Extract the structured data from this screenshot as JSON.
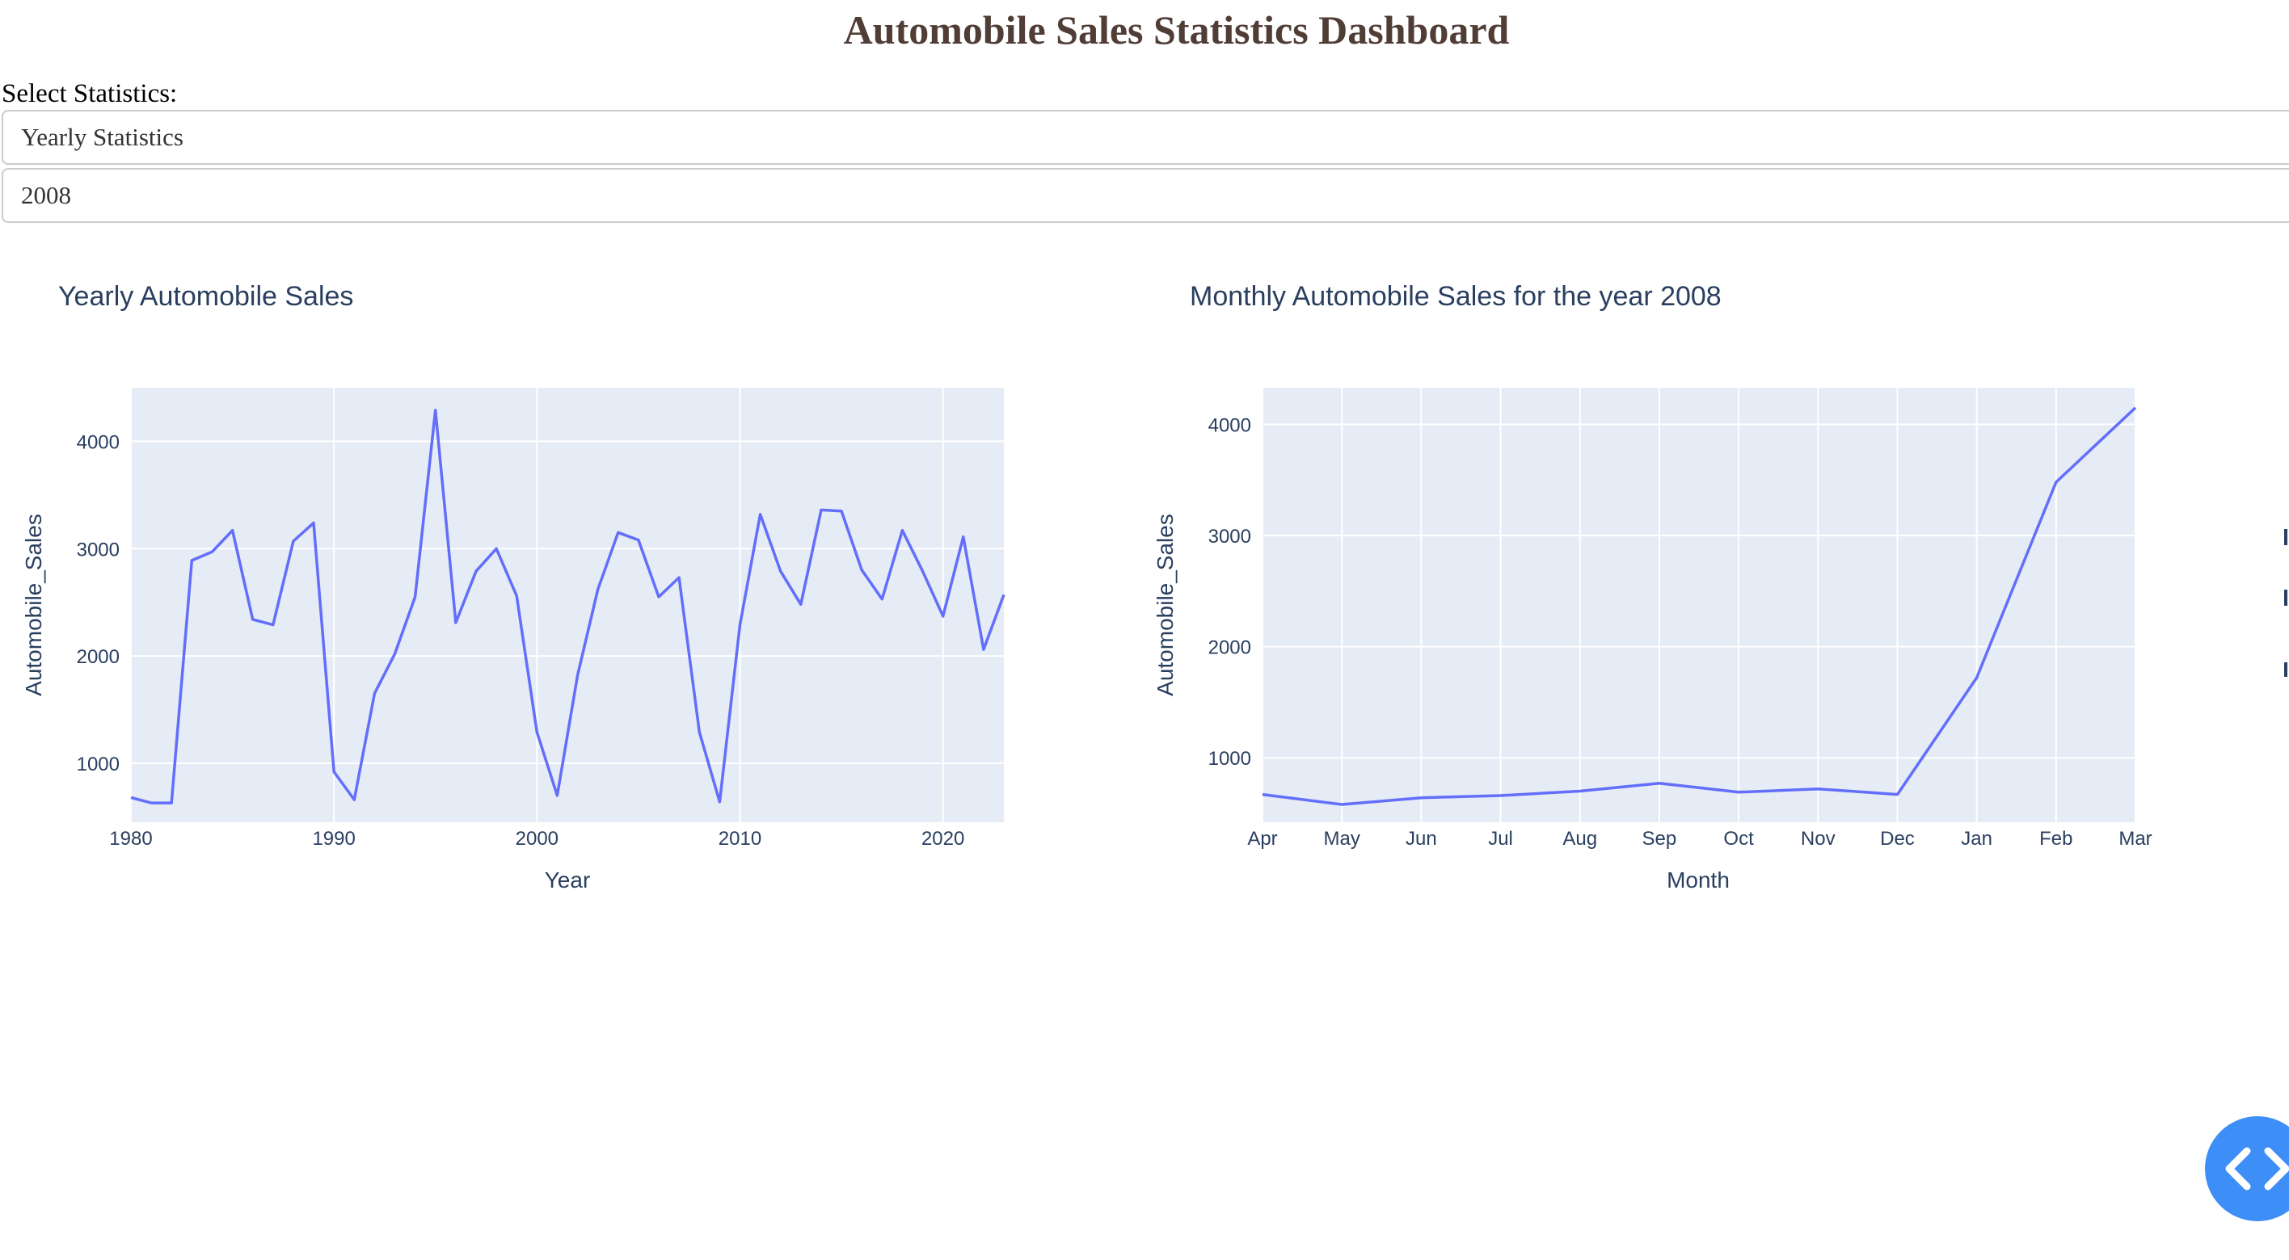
{
  "header": {
    "title": "Automobile Sales Statistics Dashboard"
  },
  "controls": {
    "select_label": "Select Statistics:",
    "statistics_dropdown": {
      "selected": "Yearly Statistics"
    },
    "year_dropdown": {
      "selected": "2008"
    }
  },
  "colors": {
    "title": "#503D36",
    "line": "#636EFA",
    "plot_bg": "#E5ECF6",
    "fab": "#3e8ef7"
  },
  "fab": {
    "icon": "code-icon"
  },
  "chart_data": [
    {
      "type": "line",
      "title": "Yearly Automobile Sales",
      "xlabel": "Year",
      "ylabel": "Automobile_Sales",
      "xlim": [
        1980,
        2023
      ],
      "ylim": [
        450,
        4500
      ],
      "x_ticks": [
        1980,
        1990,
        2000,
        2010,
        2020
      ],
      "y_ticks": [
        1000,
        2000,
        3000,
        4000
      ],
      "grid": true,
      "x": [
        1980,
        1981,
        1982,
        1983,
        1984,
        1985,
        1986,
        1987,
        1988,
        1989,
        1990,
        1991,
        1992,
        1993,
        1994,
        1995,
        1996,
        1997,
        1998,
        1999,
        2000,
        2001,
        2002,
        2003,
        2004,
        2005,
        2006,
        2007,
        2008,
        2009,
        2010,
        2011,
        2012,
        2013,
        2014,
        2015,
        2016,
        2017,
        2018,
        2019,
        2020,
        2021,
        2022,
        2023
      ],
      "values": [
        680,
        630,
        630,
        2890,
        2970,
        3170,
        2340,
        2290,
        3070,
        3240,
        920,
        660,
        1650,
        2020,
        2550,
        4290,
        2310,
        2790,
        3000,
        2560,
        1290,
        700,
        1820,
        2620,
        3150,
        3080,
        2550,
        2730,
        1290,
        640,
        2290,
        3320,
        2790,
        2480,
        3360,
        3350,
        2800,
        2530,
        3170,
        2790,
        2370,
        3110,
        2060,
        2570
      ]
    },
    {
      "type": "line",
      "title": "Monthly Automobile Sales for the year 2008",
      "xlabel": "Month",
      "ylabel": "Automobile_Sales",
      "ylim": [
        420,
        4330
      ],
      "y_ticks": [
        1000,
        2000,
        3000,
        4000
      ],
      "grid": true,
      "categories": [
        "Apr",
        "May",
        "Jun",
        "Jul",
        "Aug",
        "Sep",
        "Oct",
        "Nov",
        "Dec",
        "Jan",
        "Feb",
        "Mar"
      ],
      "values": [
        670,
        580,
        640,
        660,
        700,
        770,
        690,
        720,
        670,
        1720,
        3480,
        4150
      ]
    }
  ]
}
